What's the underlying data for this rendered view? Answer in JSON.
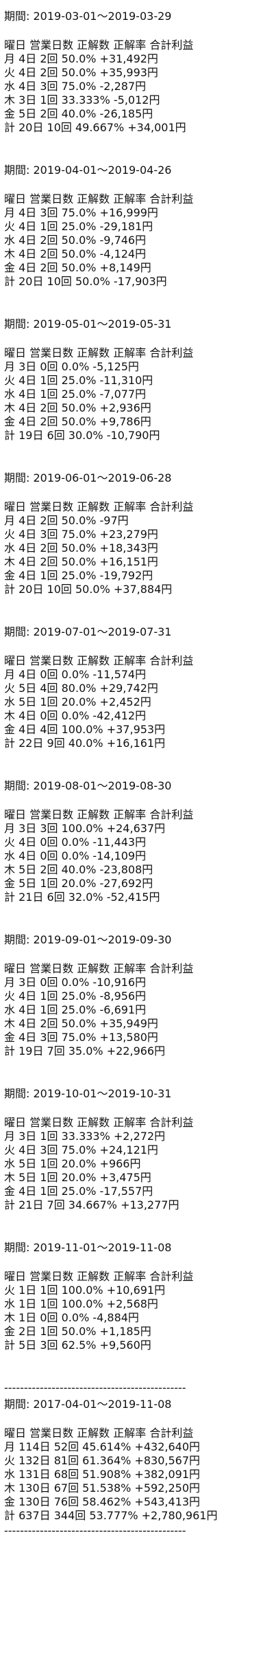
{
  "blocks": [
    {
      "period": "期間: 2019-03-01～2019-03-29",
      "header": "曜日 営業日数 正解数 正解率 合計利益",
      "rows": [
        "月 4日 2回 50.0% +31,492円",
        "火 4日 2回 50.0% +35,993円",
        "水 4日 3回 75.0% -2,287円",
        "木 3日 1回 33.333% -5,012円",
        "金 5日 2回 40.0% -26,185円",
        "計 20日 10回 49.667% +34,001円"
      ]
    },
    {
      "period": "期間: 2019-04-01～2019-04-26",
      "header": "曜日 営業日数 正解数 正解率 合計利益",
      "rows": [
        "月 4日 3回 75.0% +16,999円",
        "火 4日 1回 25.0% -29,181円",
        "水 4日 2回 50.0% -9,746円",
        "木 4日 2回 50.0% -4,124円",
        "金 4日 2回 50.0% +8,149円",
        "計 20日 10回 50.0% -17,903円"
      ]
    },
    {
      "period": "期間: 2019-05-01～2019-05-31",
      "header": "曜日 営業日数 正解数 正解率 合計利益",
      "rows": [
        "月 3日 0回 0.0% -5,125円",
        "火 4日 1回 25.0% -11,310円",
        "水 4日 1回 25.0% -7,077円",
        "木 4日 2回 50.0% +2,936円",
        "金 4日 2回 50.0% +9,786円",
        "計 19日 6回 30.0% -10,790円"
      ]
    },
    {
      "period": "期間: 2019-06-01～2019-06-28",
      "header": "曜日 営業日数 正解数 正解率 合計利益",
      "rows": [
        "月 4日 2回 50.0% -97円",
        "火 4日 3回 75.0% +23,279円",
        "水 4日 2回 50.0% +18,343円",
        "木 4日 2回 50.0% +16,151円",
        "金 4日 1回 25.0% -19,792円",
        "計 20日 10回 50.0% +37,884円"
      ]
    },
    {
      "period": "期間: 2019-07-01～2019-07-31",
      "header": "曜日 営業日数 正解数 正解率 合計利益",
      "rows": [
        "月 4日 0回 0.0% -11,574円",
        "火 5日 4回 80.0% +29,742円",
        "水 5日 1回 20.0% +2,452円",
        "木 4日 0回 0.0% -42,412円",
        "金 4日 4回 100.0% +37,953円",
        "計 22日 9回 40.0% +16,161円"
      ]
    },
    {
      "period": "期間: 2019-08-01～2019-08-30",
      "header": "曜日 営業日数 正解数 正解率 合計利益",
      "rows": [
        "月 3日 3回 100.0% +24,637円",
        "火 4日 0回 0.0% -11,443円",
        "水 4日 0回 0.0% -14,109円",
        "木 5日 2回 40.0% -23,808円",
        "金 5日 1回 20.0% -27,692円",
        "計 21日 6回 32.0% -52,415円"
      ]
    },
    {
      "period": "期間: 2019-09-01～2019-09-30",
      "header": "曜日 営業日数 正解数 正解率 合計利益",
      "rows": [
        "月 3日 0回 0.0% -10,916円",
        "火 4日 1回 25.0% -8,956円",
        "水 4日 1回 25.0% -6,691円",
        "木 4日 2回 50.0% +35,949円",
        "金 4日 3回 75.0% +13,580円",
        "計 19日 7回 35.0% +22,966円"
      ]
    },
    {
      "period": "期間: 2019-10-01～2019-10-31",
      "header": "曜日 営業日数 正解数 正解率 合計利益",
      "rows": [
        "月 3日 1回 33.333% +2,272円",
        "火 4日 3回 75.0% +24,121円",
        "水 5日 1回 20.0% +966円",
        "木 5日 1回 20.0% +3,475円",
        "金 4日 1回 25.0% -17,557円",
        "計 21日 7回 34.667% +13,277円"
      ]
    },
    {
      "period": "期間: 2019-11-01～2019-11-08",
      "header": "曜日 営業日数 正解数 正解率 合計利益",
      "rows": [
        "火 1日 1回 100.0% +10,691円",
        "水 1日 1回 100.0% +2,568円",
        "木 1日 0回 0.0% -4,884円",
        "金 2日 1回 50.0% +1,185円",
        "計 5日 3回 62.5% +9,560円"
      ]
    }
  ],
  "divider": "----------------------------------------------",
  "summary": {
    "period": "期間: 2017-04-01～2019-11-08",
    "header": "曜日 営業日数 正解数 正解率 合計利益",
    "rows": [
      "月 114日 52回 45.614% +432,640円",
      "火 132日 81回 61.364% +830,567円",
      "水 131日 68回 51.908% +382,091円",
      "木 130日 67回 51.538% +592,250円",
      "金 130日 76回 58.462% +543,413円",
      "計 637日 344回 53.777% +2,780,961円"
    ]
  }
}
